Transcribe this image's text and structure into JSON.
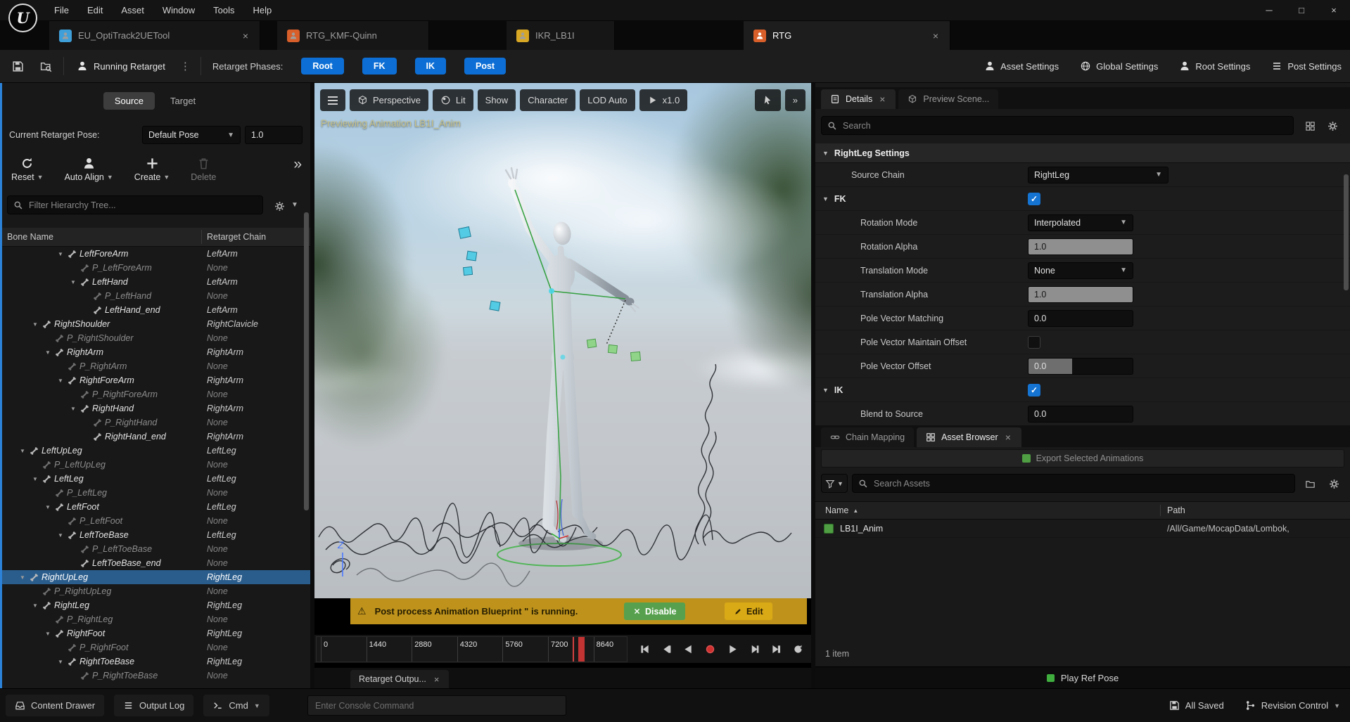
{
  "window": {
    "menu_items": [
      "File",
      "Edit",
      "Asset",
      "Window",
      "Tools",
      "Help"
    ],
    "controls": [
      {
        "name": "minimize",
        "glyph": "─"
      },
      {
        "name": "maximize",
        "glyph": "□"
      },
      {
        "name": "close",
        "glyph": "×"
      }
    ]
  },
  "tabs": [
    {
      "label": "EU_OptiTrack2UETool",
      "active": false,
      "closable": true,
      "color": "#3f9fd8"
    },
    {
      "label": "RTG_KMF-Quinn",
      "active": false,
      "closable": false,
      "color": "#d85f2a"
    },
    {
      "label": "IKR_LB1I",
      "active": false,
      "closable": false,
      "color": "#d8a825"
    },
    {
      "label": "RTG",
      "active": true,
      "closable": true,
      "color": "#d85f2a"
    }
  ],
  "toolbar": {
    "running_retarget": "Running Retarget",
    "phases_label": "Retarget Phases:",
    "phases": [
      "Root",
      "FK",
      "IK",
      "Post"
    ],
    "phase_color": "#0d6fd6",
    "settings_buttons": [
      {
        "label": "Asset Settings",
        "icon": "sym-person"
      },
      {
        "label": "Global Settings",
        "icon": "sym-globe"
      },
      {
        "label": "Root Settings",
        "icon": "sym-person"
      },
      {
        "label": "Post Settings",
        "icon": "sym-list"
      }
    ]
  },
  "left_panel": {
    "tabs": [
      {
        "label": "Source",
        "active": true
      },
      {
        "label": "Target",
        "active": false
      }
    ],
    "pose_label": "Current Retarget Pose:",
    "pose_value": "Default Pose",
    "pose_number": "1.0",
    "actions": [
      {
        "label": "Reset",
        "icon": "reset",
        "chevron": true,
        "dimmed": false
      },
      {
        "label": "Auto Align",
        "icon": "person",
        "chevron": true,
        "dimmed": false
      },
      {
        "label": "Create",
        "icon": "plus",
        "chevron": true,
        "dimmed": false
      },
      {
        "label": "Delete",
        "icon": "trash",
        "chevron": false,
        "dimmed": true
      }
    ],
    "filter_placeholder": "Filter Hierarchy Tree...",
    "columns": [
      "Bone Name",
      "Retarget Chain"
    ],
    "rows": [
      {
        "name": "LeftForeArm",
        "chain": "LeftArm",
        "level": 4,
        "p": false,
        "exp": true
      },
      {
        "name": "P_LeftForeArm",
        "chain": "None",
        "level": 5,
        "p": true,
        "exp": false
      },
      {
        "name": "LeftHand",
        "chain": "LeftArm",
        "level": 5,
        "p": false,
        "exp": true
      },
      {
        "name": "P_LeftHand",
        "chain": "None",
        "level": 6,
        "p": true,
        "exp": false
      },
      {
        "name": "LeftHand_end",
        "chain": "LeftArm",
        "level": 6,
        "p": false,
        "exp": false
      },
      {
        "name": "RightShoulder",
        "chain": "RightClavicle",
        "level": 2,
        "p": false,
        "exp": true
      },
      {
        "name": "P_RightShoulder",
        "chain": "None",
        "level": 3,
        "p": true,
        "exp": false
      },
      {
        "name": "RightArm",
        "chain": "RightArm",
        "level": 3,
        "p": false,
        "exp": true
      },
      {
        "name": "P_RightArm",
        "chain": "None",
        "level": 4,
        "p": true,
        "exp": false
      },
      {
        "name": "RightForeArm",
        "chain": "RightArm",
        "level": 4,
        "p": false,
        "exp": true
      },
      {
        "name": "P_RightForeArm",
        "chain": "None",
        "level": 5,
        "p": true,
        "exp": false
      },
      {
        "name": "RightHand",
        "chain": "RightArm",
        "level": 5,
        "p": false,
        "exp": true
      },
      {
        "name": "P_RightHand",
        "chain": "None",
        "level": 6,
        "p": true,
        "exp": false
      },
      {
        "name": "RightHand_end",
        "chain": "RightArm",
        "level": 6,
        "p": false,
        "exp": false
      },
      {
        "name": "LeftUpLeg",
        "chain": "LeftLeg",
        "level": 1,
        "p": false,
        "exp": true
      },
      {
        "name": "P_LeftUpLeg",
        "chain": "None",
        "level": 2,
        "p": true,
        "exp": false
      },
      {
        "name": "LeftLeg",
        "chain": "LeftLeg",
        "level": 2,
        "p": false,
        "exp": true
      },
      {
        "name": "P_LeftLeg",
        "chain": "None",
        "level": 3,
        "p": true,
        "exp": false
      },
      {
        "name": "LeftFoot",
        "chain": "LeftLeg",
        "level": 3,
        "p": false,
        "exp": true
      },
      {
        "name": "P_LeftFoot",
        "chain": "None",
        "level": 4,
        "p": true,
        "exp": false
      },
      {
        "name": "LeftToeBase",
        "chain": "LeftLeg",
        "level": 4,
        "p": false,
        "exp": true
      },
      {
        "name": "P_LeftToeBase",
        "chain": "None",
        "level": 5,
        "p": true,
        "exp": false
      },
      {
        "name": "LeftToeBase_end",
        "chain": "None",
        "level": 5,
        "p": false,
        "exp": false
      },
      {
        "name": "RightUpLeg",
        "chain": "RightLeg",
        "level": 1,
        "p": false,
        "exp": true,
        "selected": true
      },
      {
        "name": "P_RightUpLeg",
        "chain": "None",
        "level": 2,
        "p": true,
        "exp": false
      },
      {
        "name": "RightLeg",
        "chain": "RightLeg",
        "level": 2,
        "p": false,
        "exp": true
      },
      {
        "name": "P_RightLeg",
        "chain": "None",
        "level": 3,
        "p": true,
        "exp": false
      },
      {
        "name": "RightFoot",
        "chain": "RightLeg",
        "level": 3,
        "p": false,
        "exp": true
      },
      {
        "name": "P_RightFoot",
        "chain": "None",
        "level": 4,
        "p": true,
        "exp": false
      },
      {
        "name": "RightToeBase",
        "chain": "RightLeg",
        "level": 4,
        "p": false,
        "exp": true
      },
      {
        "name": "P_RightToeBase",
        "chain": "None",
        "level": 5,
        "p": true,
        "exp": false
      }
    ]
  },
  "viewport": {
    "toolbar": [
      {
        "label": "",
        "icon": "menu",
        "name": "viewport-menu"
      },
      {
        "label": "Perspective",
        "icon": "cube"
      },
      {
        "label": "Lit",
        "icon": "sphere"
      },
      {
        "label": "Show"
      },
      {
        "label": "Character"
      },
      {
        "label": "LOD Auto"
      },
      {
        "label": "x1.0",
        "icon": "play"
      }
    ],
    "preview_label": "Previewing Animation LB1I_Anim",
    "warning": {
      "icon": "⚠",
      "text": "Post process Animation Blueprint \" is running.",
      "disable_label": "Disable",
      "edit_label": "Edit"
    },
    "timeline": {
      "ticks": [
        "0",
        "1440",
        "2880",
        "4320",
        "5760",
        "7200",
        "8640"
      ]
    },
    "output_tab": "Retarget Outpu..."
  },
  "details": {
    "tab_label": "Details",
    "preview_tab_label": "Preview Scene...",
    "search_placeholder": "Search",
    "section_label": "RightLeg Settings",
    "properties": [
      {
        "label": "Source Chain",
        "widget": "dropdown",
        "value": "RightLeg",
        "indent": 1,
        "wide": true
      },
      {
        "label": "FK",
        "widget": "header-check",
        "checked": true,
        "indent": 0
      },
      {
        "label": "Rotation Mode",
        "widget": "dropdown",
        "value": "Interpolated",
        "indent": 2
      },
      {
        "label": "Rotation Alpha",
        "widget": "slider",
        "value": "1.0",
        "indent": 2
      },
      {
        "label": "Translation Mode",
        "widget": "dropdown",
        "value": "None",
        "indent": 2
      },
      {
        "label": "Translation Alpha",
        "widget": "slider",
        "value": "1.0",
        "indent": 2
      },
      {
        "label": "Pole Vector Matching",
        "widget": "field",
        "value": "0.0",
        "indent": 2
      },
      {
        "label": "Pole Vector Maintain Offset",
        "widget": "checkbox",
        "checked": false,
        "indent": 2
      },
      {
        "label": "Pole Vector Offset",
        "widget": "slider-dark",
        "value": "0.0",
        "fill": 0.42,
        "indent": 2
      },
      {
        "label": "IK",
        "widget": "header-check",
        "checked": true,
        "indent": 0
      },
      {
        "label": "Blend to Source",
        "widget": "field",
        "value": "0.0",
        "indent": 2
      }
    ]
  },
  "asset_browser": {
    "tabs": [
      {
        "label": "Chain Mapping",
        "active": false,
        "closable": false,
        "icon": "sym-chain"
      },
      {
        "label": "Asset Browser",
        "active": true,
        "closable": true,
        "icon": "sym-grid"
      }
    ],
    "export_label": "Export Selected Animations",
    "search_placeholder": "Search Assets",
    "columns": [
      "Name",
      "Path"
    ],
    "rows": [
      {
        "name": "LB1I_Anim",
        "path": "/All/Game/MocapData/Lombok,"
      }
    ],
    "count_label": "1 item",
    "play_ref_label": "Play Ref Pose"
  },
  "status_bar": {
    "content_drawer": "Content Drawer",
    "output_log": "Output Log",
    "cmd": "Cmd",
    "console_placeholder": "Enter Console Command",
    "all_saved": "All Saved",
    "revision_control": "Revision Control"
  }
}
